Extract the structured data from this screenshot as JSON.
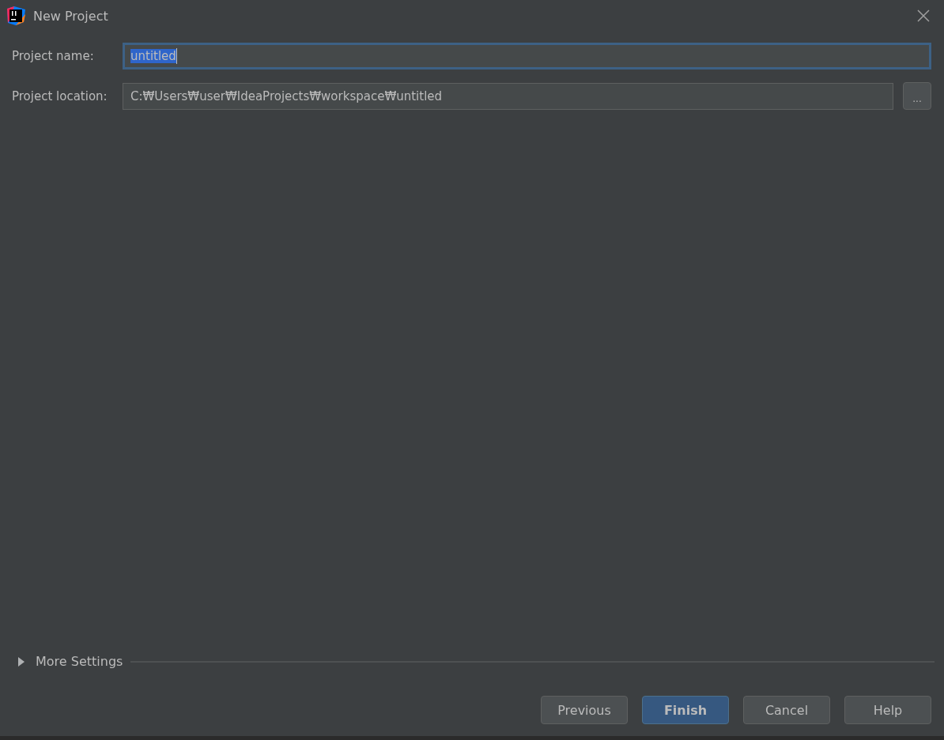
{
  "window": {
    "title": "New Project"
  },
  "fields": [
    {
      "label": "Project name:",
      "value": "untitled",
      "focused": true
    },
    {
      "label": "Project location:",
      "value": "C:₩Users₩user₩IdeaProjects₩workspace₩untitled",
      "focused": false,
      "browse_button": "..."
    }
  ],
  "more_settings": {
    "label": "More Settings",
    "expanded": false
  },
  "buttons": [
    {
      "label": "Previous",
      "default": false
    },
    {
      "label": "Finish",
      "default": true
    },
    {
      "label": "Cancel",
      "default": false
    },
    {
      "label": "Help",
      "default": false
    }
  ]
}
